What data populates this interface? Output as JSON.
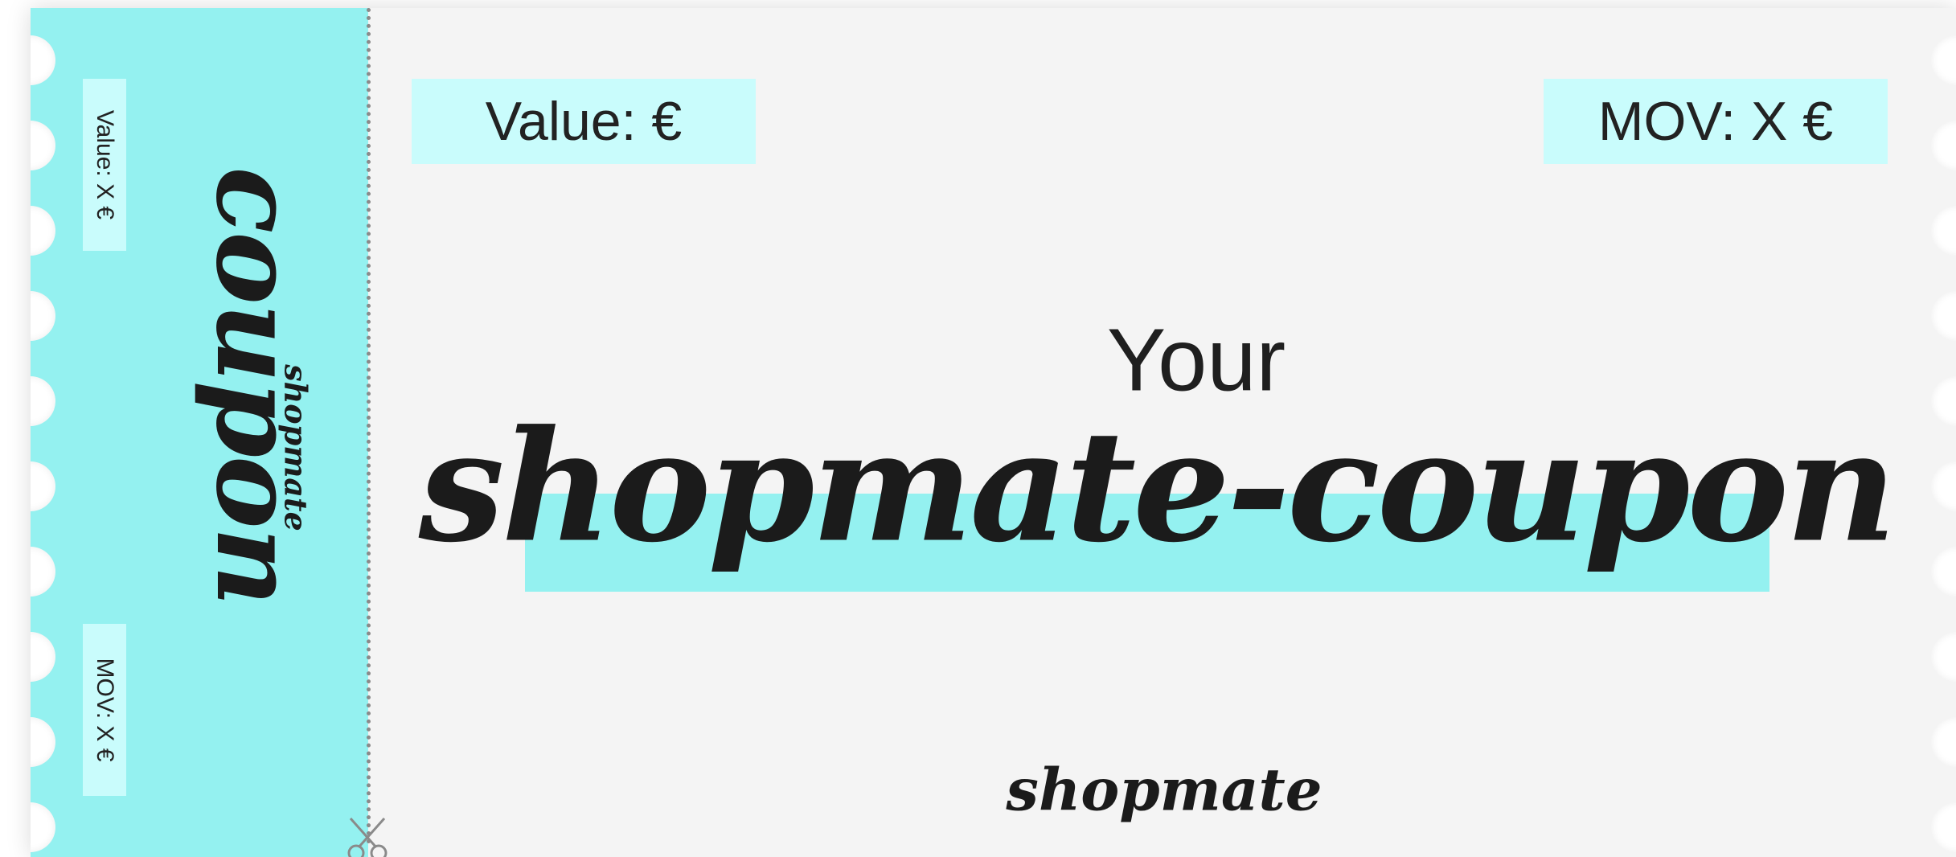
{
  "stub": {
    "value_label": "Value: X €",
    "mov_label": "MOV: X €",
    "coupon_word": "coupon",
    "brand": "shopmate"
  },
  "main": {
    "value_label": "Value:  €",
    "mov_label": "MOV: X €",
    "headline_top": "Your",
    "headline_main": "shopmate-coupon",
    "brand": "shopmate"
  },
  "icons": {
    "scissors": "scissors-icon"
  },
  "colors": {
    "accent": "#94f1f0",
    "chip": "#c9fcfc",
    "paper": "#f4f4f4",
    "text": "#1b1b1b"
  }
}
